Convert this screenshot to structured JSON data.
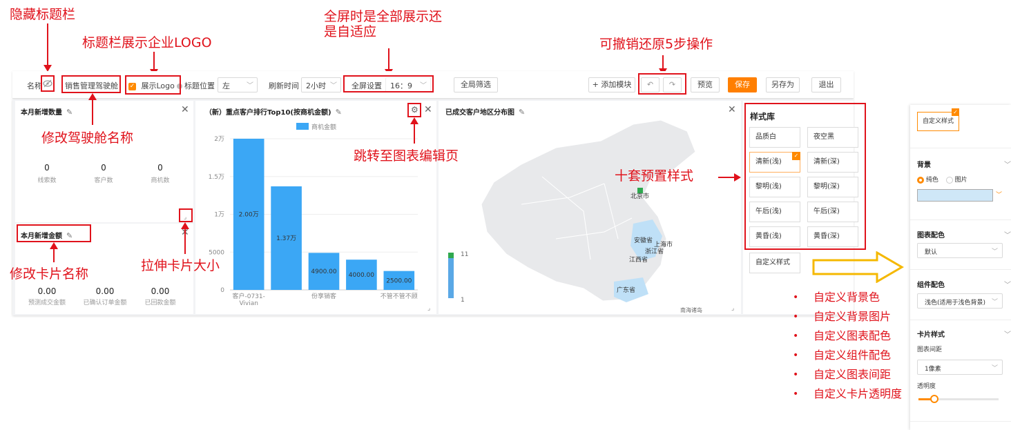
{
  "annotations": {
    "hide_titlebar": "隐藏标题栏",
    "show_logo": "标题栏展示企业LOGO",
    "fullscreen_line1": "全屏时是全部展示还",
    "fullscreen_line2": "是自适应",
    "undo_redo": "可撤销还原5步操作",
    "rename_cockpit": "修改驾驶舱名称",
    "goto_editor": "跳转至图表编辑页",
    "ten_presets": "十套预置样式",
    "rename_card": "修改卡片名称",
    "resize_card": "拉伸卡片大小",
    "custom_list": [
      "自定义背景色",
      "自定义背景图片",
      "自定义图表配色",
      "自定义组件配色",
      "自定义图表间距",
      "自定义卡片透明度"
    ]
  },
  "toolbar": {
    "name_label": "名称",
    "name_value": "销售管理驾驶舱",
    "show_logo": "展示Logo",
    "title_pos_label": "标题位置",
    "title_pos_value": "左",
    "refresh_label": "刷新时间",
    "refresh_value": "2小时",
    "fullscreen_label": "全屏设置",
    "fullscreen_value": "16：9",
    "global_filter": "全局筛选",
    "add_module": "+ 添加模块",
    "preview": "预览",
    "save": "保存",
    "save_as": "另存为",
    "exit": "退出"
  },
  "card1": {
    "title": "本月新增数量",
    "kpis": [
      {
        "value": "0",
        "label": "线索数"
      },
      {
        "value": "0",
        "label": "客户数"
      },
      {
        "value": "0",
        "label": "商机数"
      }
    ]
  },
  "card2": {
    "title": "本月新增金额",
    "kpis": [
      {
        "value": "0.00",
        "label": "预测成交金额"
      },
      {
        "value": "0.00",
        "label": "已确认订单金额"
      },
      {
        "value": "0.00",
        "label": "已回款金额"
      }
    ]
  },
  "bar_card": {
    "title": "（新）重点客户排行Top10(按商机金额)"
  },
  "chart_data": {
    "type": "bar",
    "legend": "商机金额",
    "categories": [
      "客户-0731-Vivian",
      "",
      "份享销客",
      "",
      "不管不管不顾"
    ],
    "values": [
      20000,
      13700,
      4900,
      4000,
      2500
    ],
    "data_labels": [
      "2.00万",
      "1.37万",
      "4900.00",
      "4000.00",
      "2500.00"
    ],
    "yticks": [
      "0",
      "5000",
      "1万",
      "1.5万",
      "2万"
    ],
    "ylim": [
      0,
      20000
    ],
    "color": "#3ba7f5"
  },
  "map_card": {
    "title": "已成交客户地区分布图",
    "labels": [
      "北京市",
      "安徽省",
      "上海市",
      "浙江省",
      "江西省",
      "广东省"
    ],
    "legend_max": "11",
    "legend_min": "1",
    "footer": "南海诸岛"
  },
  "style_library": {
    "title": "样式库",
    "styles": [
      "品质白",
      "夜空黑",
      "清新(浅)",
      "清新(深)",
      "黎明(浅)",
      "黎明(深)",
      "午后(浅)",
      "午后(深)",
      "黄昏(浅)",
      "黄昏(深)"
    ],
    "selected": "清新(浅)",
    "custom": "自定义样式"
  },
  "settings": {
    "custom_style": "自定义样式",
    "bg_title": "背景",
    "bg_color": "纯色",
    "bg_image": "图片",
    "swatch_color": "#cfe7f7",
    "chart_palette_title": "图表配色",
    "chart_palette_value": "默认",
    "component_palette_title": "组件配色",
    "component_palette_value": "浅色(适用于浅色背景)",
    "card_style_title": "卡片样式",
    "spacing_label": "图表间距",
    "spacing_value": "1像素",
    "opacity_label": "透明度",
    "opacity": 0.2
  }
}
